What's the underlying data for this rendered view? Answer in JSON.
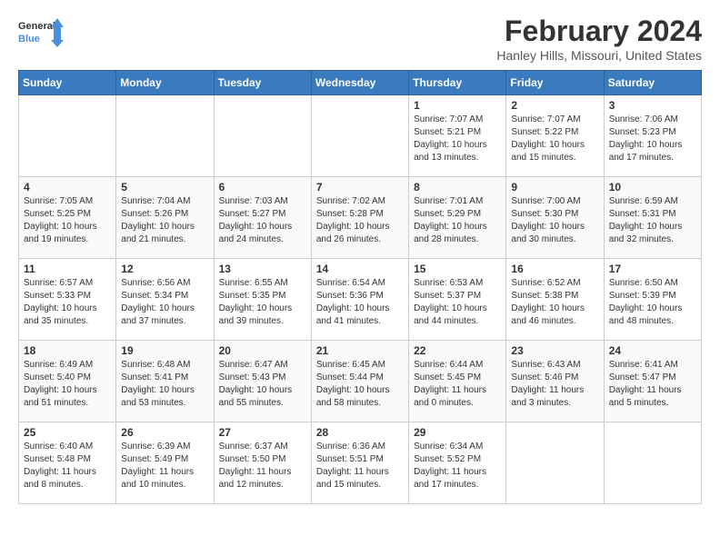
{
  "header": {
    "logo_line1": "General",
    "logo_line2": "Blue",
    "title": "February 2024",
    "subtitle": "Hanley Hills, Missouri, United States"
  },
  "weekdays": [
    "Sunday",
    "Monday",
    "Tuesday",
    "Wednesday",
    "Thursday",
    "Friday",
    "Saturday"
  ],
  "weeks": [
    [
      {
        "day": "",
        "info": ""
      },
      {
        "day": "",
        "info": ""
      },
      {
        "day": "",
        "info": ""
      },
      {
        "day": "",
        "info": ""
      },
      {
        "day": "1",
        "info": "Sunrise: 7:07 AM\nSunset: 5:21 PM\nDaylight: 10 hours\nand 13 minutes."
      },
      {
        "day": "2",
        "info": "Sunrise: 7:07 AM\nSunset: 5:22 PM\nDaylight: 10 hours\nand 15 minutes."
      },
      {
        "day": "3",
        "info": "Sunrise: 7:06 AM\nSunset: 5:23 PM\nDaylight: 10 hours\nand 17 minutes."
      }
    ],
    [
      {
        "day": "4",
        "info": "Sunrise: 7:05 AM\nSunset: 5:25 PM\nDaylight: 10 hours\nand 19 minutes."
      },
      {
        "day": "5",
        "info": "Sunrise: 7:04 AM\nSunset: 5:26 PM\nDaylight: 10 hours\nand 21 minutes."
      },
      {
        "day": "6",
        "info": "Sunrise: 7:03 AM\nSunset: 5:27 PM\nDaylight: 10 hours\nand 24 minutes."
      },
      {
        "day": "7",
        "info": "Sunrise: 7:02 AM\nSunset: 5:28 PM\nDaylight: 10 hours\nand 26 minutes."
      },
      {
        "day": "8",
        "info": "Sunrise: 7:01 AM\nSunset: 5:29 PM\nDaylight: 10 hours\nand 28 minutes."
      },
      {
        "day": "9",
        "info": "Sunrise: 7:00 AM\nSunset: 5:30 PM\nDaylight: 10 hours\nand 30 minutes."
      },
      {
        "day": "10",
        "info": "Sunrise: 6:59 AM\nSunset: 5:31 PM\nDaylight: 10 hours\nand 32 minutes."
      }
    ],
    [
      {
        "day": "11",
        "info": "Sunrise: 6:57 AM\nSunset: 5:33 PM\nDaylight: 10 hours\nand 35 minutes."
      },
      {
        "day": "12",
        "info": "Sunrise: 6:56 AM\nSunset: 5:34 PM\nDaylight: 10 hours\nand 37 minutes."
      },
      {
        "day": "13",
        "info": "Sunrise: 6:55 AM\nSunset: 5:35 PM\nDaylight: 10 hours\nand 39 minutes."
      },
      {
        "day": "14",
        "info": "Sunrise: 6:54 AM\nSunset: 5:36 PM\nDaylight: 10 hours\nand 41 minutes."
      },
      {
        "day": "15",
        "info": "Sunrise: 6:53 AM\nSunset: 5:37 PM\nDaylight: 10 hours\nand 44 minutes."
      },
      {
        "day": "16",
        "info": "Sunrise: 6:52 AM\nSunset: 5:38 PM\nDaylight: 10 hours\nand 46 minutes."
      },
      {
        "day": "17",
        "info": "Sunrise: 6:50 AM\nSunset: 5:39 PM\nDaylight: 10 hours\nand 48 minutes."
      }
    ],
    [
      {
        "day": "18",
        "info": "Sunrise: 6:49 AM\nSunset: 5:40 PM\nDaylight: 10 hours\nand 51 minutes."
      },
      {
        "day": "19",
        "info": "Sunrise: 6:48 AM\nSunset: 5:41 PM\nDaylight: 10 hours\nand 53 minutes."
      },
      {
        "day": "20",
        "info": "Sunrise: 6:47 AM\nSunset: 5:43 PM\nDaylight: 10 hours\nand 55 minutes."
      },
      {
        "day": "21",
        "info": "Sunrise: 6:45 AM\nSunset: 5:44 PM\nDaylight: 10 hours\nand 58 minutes."
      },
      {
        "day": "22",
        "info": "Sunrise: 6:44 AM\nSunset: 5:45 PM\nDaylight: 11 hours\nand 0 minutes."
      },
      {
        "day": "23",
        "info": "Sunrise: 6:43 AM\nSunset: 5:46 PM\nDaylight: 11 hours\nand 3 minutes."
      },
      {
        "day": "24",
        "info": "Sunrise: 6:41 AM\nSunset: 5:47 PM\nDaylight: 11 hours\nand 5 minutes."
      }
    ],
    [
      {
        "day": "25",
        "info": "Sunrise: 6:40 AM\nSunset: 5:48 PM\nDaylight: 11 hours\nand 8 minutes."
      },
      {
        "day": "26",
        "info": "Sunrise: 6:39 AM\nSunset: 5:49 PM\nDaylight: 11 hours\nand 10 minutes."
      },
      {
        "day": "27",
        "info": "Sunrise: 6:37 AM\nSunset: 5:50 PM\nDaylight: 11 hours\nand 12 minutes."
      },
      {
        "day": "28",
        "info": "Sunrise: 6:36 AM\nSunset: 5:51 PM\nDaylight: 11 hours\nand 15 minutes."
      },
      {
        "day": "29",
        "info": "Sunrise: 6:34 AM\nSunset: 5:52 PM\nDaylight: 11 hours\nand 17 minutes."
      },
      {
        "day": "",
        "info": ""
      },
      {
        "day": "",
        "info": ""
      }
    ]
  ]
}
